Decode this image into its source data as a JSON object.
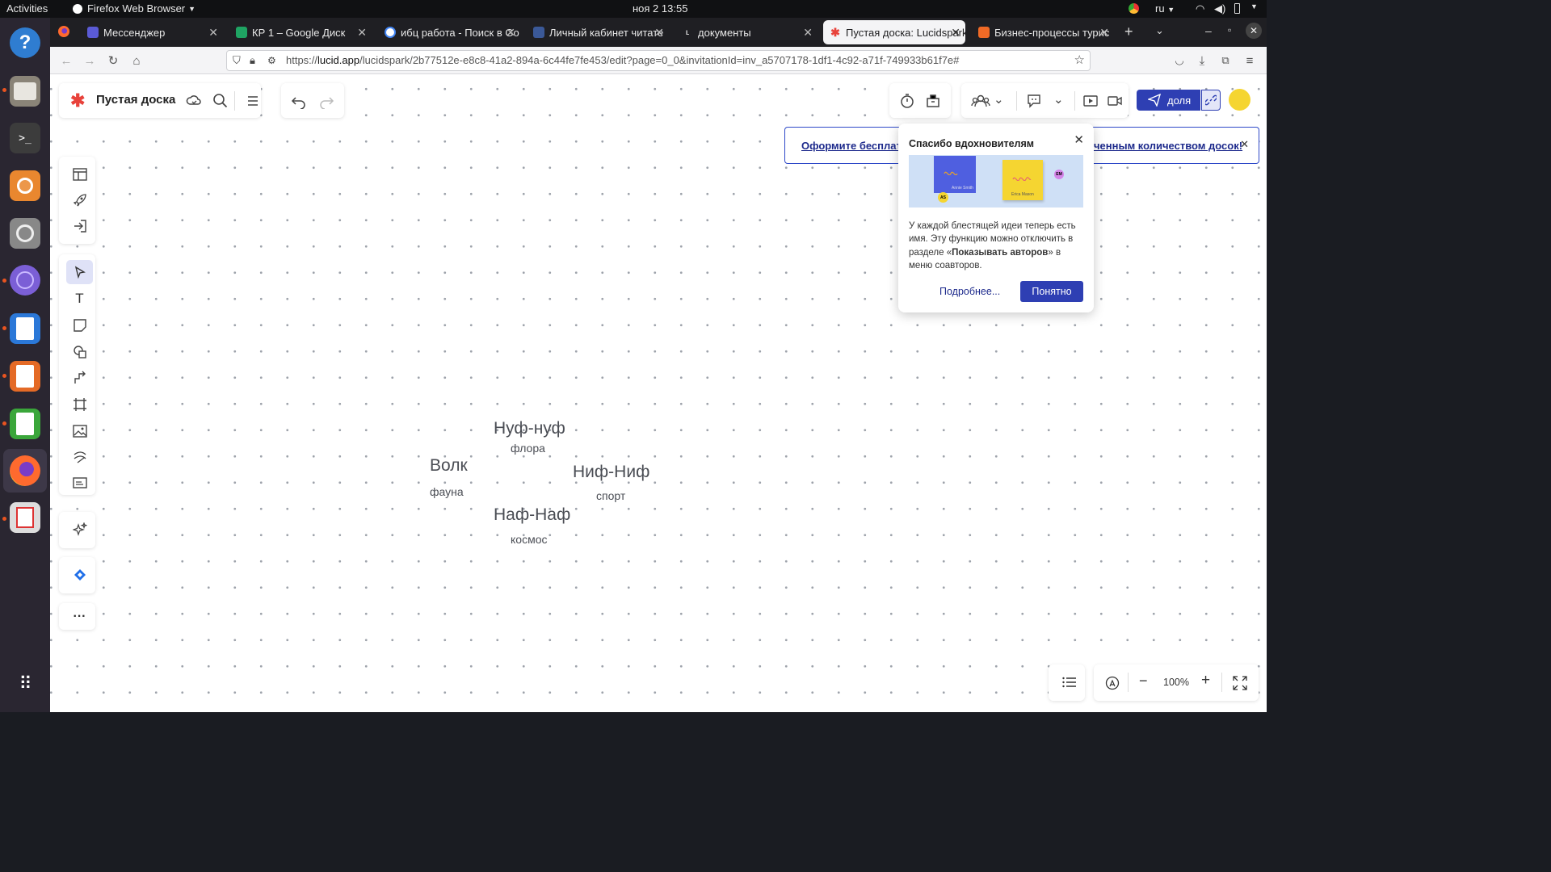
{
  "system": {
    "activities": "Activities",
    "app_menu": "Firefox Web Browser",
    "datetime": "ноя 2  13:55",
    "lang": "ru"
  },
  "tabs": [
    {
      "label": "Мессенджер",
      "icon": "messenger-icon",
      "color": "#5b5bd6"
    },
    {
      "label": "КР 1 – Google Диск",
      "icon": "google-drive-icon",
      "color": "#1fa463"
    },
    {
      "label": "ибц работа - Поиск в Go",
      "icon": "google-icon",
      "color": "#4285f4"
    },
    {
      "label": "Личный кабинет читате",
      "icon": "library-icon",
      "color": "#3b5998"
    },
    {
      "label": "документы",
      "icon": "lucid-icon",
      "color": "#444444"
    },
    {
      "label": "Пустая доска: Lucidspark",
      "icon": "lucidspark-icon",
      "color": "#e8423b"
    },
    {
      "label": "Бизнес-процессы турис",
      "icon": "lucidchart-icon",
      "color": "#f06a26"
    }
  ],
  "url": {
    "prefix": "https://",
    "host": "lucid.app",
    "path": "/lucidspark/2b77512e-e8c8-41a2-894a-6c44fe7fe453/edit?page=0_0&invitationId=inv_a5707178-1df1-4c92-a71f-749933b61f7e#"
  },
  "board": {
    "title": "Пустая доска"
  },
  "share": {
    "label": "доля"
  },
  "banner": {
    "left_text": "Оформите бесплатн",
    "right_text": "ченным количеством досок!"
  },
  "popup": {
    "title": "Спасибо вдохновителям",
    "body_pre": "У каждой блестящей идеи теперь есть имя. Эту функцию можно отключить в разделе «",
    "body_bold": "Показывать авторов",
    "body_post": "» в меню соавторов.",
    "more": "Подробнее...",
    "ok": "Понятно",
    "note1_name": "Annie Smith",
    "note2_name": "Erica Mason",
    "badge1": "AS",
    "badge2": "EM"
  },
  "words": [
    {
      "title": "Нуф-нуф",
      "sub": "флора"
    },
    {
      "title": "Волк",
      "sub": "фауна"
    },
    {
      "title": "Ниф-Ниф",
      "sub": "спорт"
    },
    {
      "title": "Наф-Наф",
      "sub": "космос"
    }
  ],
  "zoom": {
    "value": "100%"
  }
}
